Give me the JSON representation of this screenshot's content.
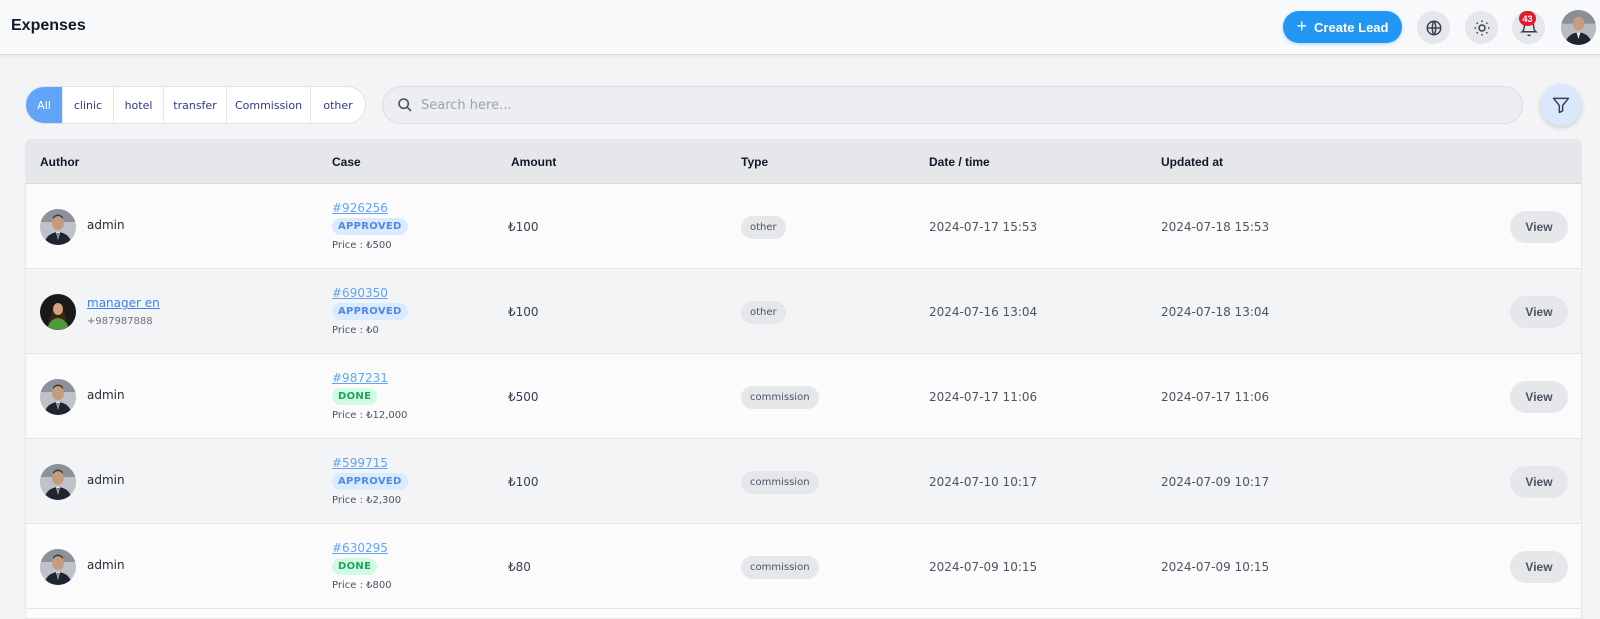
{
  "header": {
    "title": "Expenses",
    "create_label": "Create Lead",
    "notification_count": "43",
    "icons": [
      "globe-icon",
      "sun-icon",
      "bell-icon"
    ]
  },
  "filters": {
    "tabs": [
      {
        "label": "All",
        "active": true
      },
      {
        "label": "clinic",
        "active": false
      },
      {
        "label": "hotel",
        "active": false
      },
      {
        "label": "transfer",
        "active": false
      },
      {
        "label": "Commission",
        "active": false
      },
      {
        "label": "other",
        "active": false
      }
    ],
    "search_placeholder": "Search here..."
  },
  "table": {
    "columns": [
      "Author",
      "Case",
      "Amount",
      "Type",
      "Date / time",
      "Updated at"
    ],
    "view_label": "View",
    "rows": [
      {
        "author": "admin",
        "phone": "",
        "author_link": false,
        "avatar": "admin",
        "case": "#926256",
        "status": "APPROVED",
        "price": "Price : ₺500",
        "amount": "₺100",
        "type": "other",
        "datetime": "2024-07-17 15:53",
        "updated": "2024-07-18 15:53"
      },
      {
        "author": "manager en",
        "phone": "+987987888",
        "author_link": true,
        "avatar": "manager",
        "case": "#690350",
        "status": "APPROVED",
        "price": "Price : ₺0",
        "amount": "₺100",
        "type": "other",
        "datetime": "2024-07-16 13:04",
        "updated": "2024-07-18 13:04"
      },
      {
        "author": "admin",
        "phone": "",
        "author_link": false,
        "avatar": "admin",
        "case": "#987231",
        "status": "DONE",
        "price": "Price : ₺12,000",
        "amount": "₺500",
        "type": "commission",
        "datetime": "2024-07-17 11:06",
        "updated": "2024-07-17 11:06"
      },
      {
        "author": "admin",
        "phone": "",
        "author_link": false,
        "avatar": "admin",
        "case": "#599715",
        "status": "APPROVED",
        "price": "Price : ₺2,300",
        "amount": "₺100",
        "type": "commission",
        "datetime": "2024-07-10 10:17",
        "updated": "2024-07-09 10:17"
      },
      {
        "author": "admin",
        "phone": "",
        "author_link": false,
        "avatar": "admin",
        "case": "#630295",
        "status": "DONE",
        "price": "Price : ₺800",
        "amount": "₺80",
        "type": "commission",
        "datetime": "2024-07-09 10:15",
        "updated": "2024-07-09 10:15"
      }
    ]
  },
  "colors": {
    "accent": "#2196f3",
    "active_tab": "#60a5fa",
    "badge": "#e11d2b",
    "approved": "#4f8ae6",
    "done": "#22a35a"
  }
}
